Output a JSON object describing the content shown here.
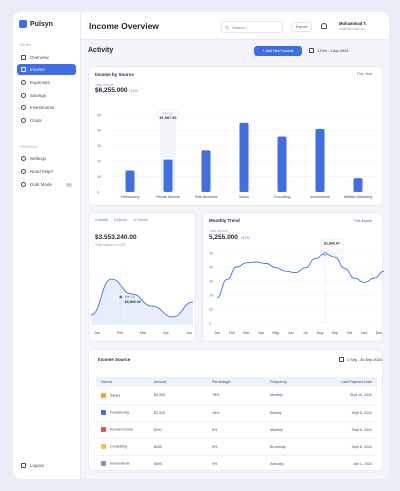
{
  "app": {
    "name": "Pulsyn"
  },
  "sidebar": {
    "menu_heading": "MENU",
    "general_heading": "GENERAL",
    "items": [
      {
        "label": "Overview",
        "icon": "grid-icon"
      },
      {
        "label": "Income",
        "icon": "wallet-icon",
        "active": true
      },
      {
        "label": "Expenses",
        "icon": "receipt-icon"
      },
      {
        "label": "Savings",
        "icon": "piggy-bank-icon"
      },
      {
        "label": "Investments",
        "icon": "trend-icon"
      },
      {
        "label": "Goals",
        "icon": "target-icon"
      }
    ],
    "general_items": [
      {
        "label": "Settings",
        "icon": "gear-icon"
      },
      {
        "label": "Need help?",
        "icon": "help-icon"
      },
      {
        "label": "Dark Mode",
        "icon": "moon-icon"
      }
    ],
    "logout": "Logout"
  },
  "header": {
    "title": "Income Overview",
    "search_placeholder": "Search...",
    "export_label": "Export",
    "user_name": "Muhammad T.",
    "user_email": "email@email.com"
  },
  "activity": {
    "title": "Activity",
    "add_button": "+ Add New Income",
    "date_range": "1 Feb - 1 Apr 2024"
  },
  "income_by_source": {
    "title": "Income by Source",
    "period": "This Year",
    "total_label": "Total Income",
    "total_value": "$6,255.000",
    "change": "+12%",
    "tooltip_label": "Rental",
    "tooltip_value": "$1,997.50"
  },
  "four_month": {
    "tabs": [
      "4 Month",
      "6 Month",
      "12 Month"
    ],
    "value": "$3.553.240.00",
    "sublabel": "Total balance in USD",
    "tooltip_label": "Mar 20",
    "tooltip_value": "$6,800.00"
  },
  "monthly_trend": {
    "title": "Monthly Trend",
    "period": "This Month",
    "total_label": "Total Income",
    "total_value": "5,255.000",
    "change": "+12%",
    "tooltip_value": "$1,660.67"
  },
  "income_source_table": {
    "title": "Income Source",
    "date_range": "1 Sep - 30 Sep 2024",
    "columns": [
      "Source",
      "Amount",
      "Percentage",
      "Frequency",
      "Last Payment Date"
    ],
    "rows": [
      {
        "source": "Salary",
        "amount": "$4,300",
        "percentage": "78%",
        "frequency": "Monthly",
        "date": "Sept 10, 2024",
        "color": "#f2a33c"
      },
      {
        "source": "Freelancing",
        "amount": "$1,330",
        "percentage": "18%",
        "frequency": "Weekly",
        "date": "Sept 8, 2024",
        "color": "#3f6fe0"
      },
      {
        "source": "Rental Income",
        "amount": "$291",
        "percentage": "8%",
        "frequency": "Monthly",
        "date": "Sept 5, 2024",
        "color": "#e0524f"
      },
      {
        "source": "Consulting",
        "amount": "$400",
        "percentage": "9%",
        "frequency": "Bi-weekly",
        "date": "Sept 8, 2024",
        "color": "#f4c542"
      },
      {
        "source": "Investments",
        "amount": "$490",
        "percentage": "9%",
        "frequency": "Annually",
        "date": "Jan 1, 2024",
        "color": "#8a94a6"
      }
    ]
  },
  "chart_data": [
    {
      "type": "bar",
      "categories": [
        "Freelancing",
        "Rental Income",
        "Side Business",
        "Salary",
        "Consulting",
        "Investments",
        "Affiliate Marketing"
      ],
      "values": [
        1400,
        2100,
        2700,
        4500,
        3600,
        4100,
        900
      ],
      "ylim": [
        0,
        5000
      ],
      "yticks": [
        "0",
        "1K",
        "2K",
        "3K",
        "4K",
        "5K"
      ],
      "color": "#3f6fe0"
    },
    {
      "type": "line",
      "x": [
        "Jan",
        "Feb",
        "Mar",
        "Apr",
        "Jun"
      ],
      "values": [
        1.5,
        6.8,
        4.6,
        2.8,
        1.2,
        3.4
      ],
      "color": "#3f6fe0"
    },
    {
      "type": "line",
      "x": [
        "Jan",
        "Feb",
        "Mar",
        "Apr",
        "May",
        "Jun",
        "Jul",
        "Aug",
        "Sep",
        "Oct",
        "Nov",
        "Dec"
      ],
      "values": [
        1800,
        3100,
        4000,
        4300,
        4350,
        4250,
        3950,
        3700,
        3600,
        3950,
        4600,
        4950,
        4700,
        3900,
        3200,
        2900,
        3200,
        3700
      ],
      "ylim": [
        0,
        5000
      ],
      "yticks": [
        "0",
        "1K",
        "2K",
        "3K",
        "4K",
        "5K"
      ],
      "color": "#3f6fe0"
    }
  ]
}
